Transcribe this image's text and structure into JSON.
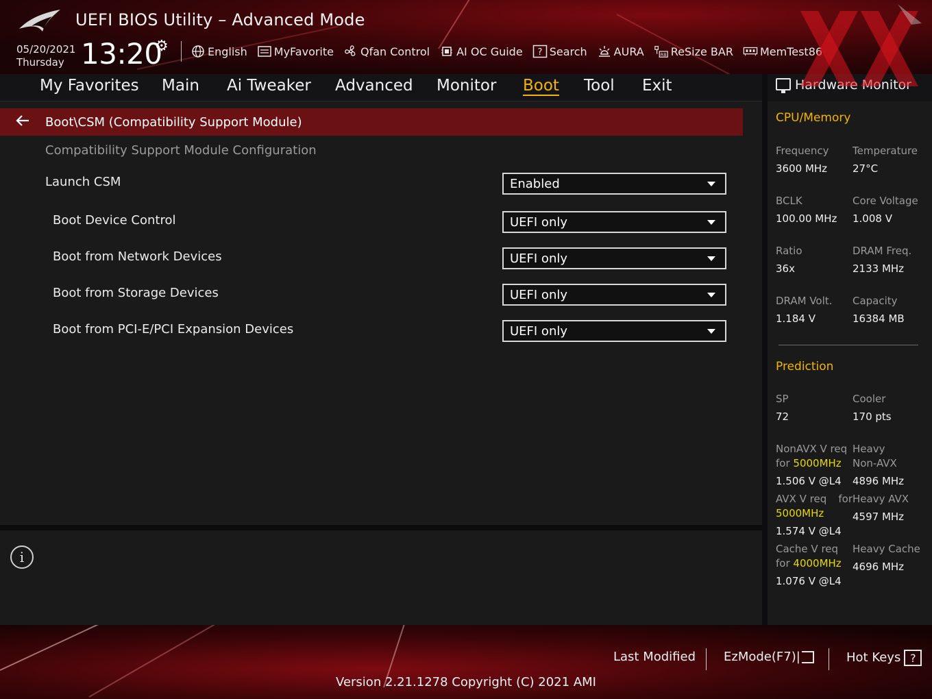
{
  "header": {
    "title": "UEFI BIOS Utility – Advanced Mode",
    "date": "05/20/2021",
    "day": "Thursday",
    "time": "13:20"
  },
  "toolbar": {
    "items": [
      {
        "label": "English",
        "icon": "globe-icon"
      },
      {
        "label": "MyFavorite",
        "icon": "favorite-list-icon"
      },
      {
        "label": "Qfan Control",
        "icon": "fan-icon"
      },
      {
        "label": "AI OC Guide",
        "icon": "chip-icon"
      },
      {
        "label": "Search",
        "icon": "question-box-icon"
      },
      {
        "label": "AURA",
        "icon": "light-icon"
      },
      {
        "label": "ReSize BAR",
        "icon": "resize-bar-icon"
      },
      {
        "label": "MemTest86",
        "icon": "memory-icon"
      }
    ]
  },
  "tabs": [
    "My Favorites",
    "Main",
    "Ai Tweaker",
    "Advanced",
    "Monitor",
    "Boot",
    "Tool",
    "Exit"
  ],
  "active_tab": "Boot",
  "main": {
    "breadcrumb": "Boot\\CSM (Compatibility Support Module)",
    "section_title": "Compatibility Support Module Configuration",
    "settings": [
      {
        "label": "Launch CSM",
        "value": "Enabled"
      },
      {
        "label": "Boot Device Control",
        "value": "UEFI only"
      },
      {
        "label": "Boot from Network Devices",
        "value": "UEFI only"
      },
      {
        "label": "Boot from Storage Devices",
        "value": "UEFI only"
      },
      {
        "label": "Boot from PCI-E/PCI Expansion Devices",
        "value": "UEFI only"
      }
    ]
  },
  "hardware_monitor": {
    "title": "Hardware Monitor",
    "cpu_memory": {
      "title": "CPU/Memory",
      "frequency_label": "Frequency",
      "frequency": "3600 MHz",
      "temperature_label": "Temperature",
      "temperature": "27°C",
      "bclk_label": "BCLK",
      "bclk": "100.00 MHz",
      "core_voltage_label": "Core Voltage",
      "core_voltage": "1.008 V",
      "ratio_label": "Ratio",
      "ratio": "36x",
      "dram_freq_label": "DRAM Freq.",
      "dram_freq": "2133 MHz",
      "dram_volt_label": "DRAM Volt.",
      "dram_volt": "1.184 V",
      "capacity_label": "Capacity",
      "capacity": "16384 MB"
    },
    "prediction": {
      "title": "Prediction",
      "sp_label": "SP",
      "sp": "72",
      "cooler_label": "Cooler",
      "cooler": "170 pts",
      "nonavx_label_1": "NonAVX V req",
      "nonavx_label_2": "for",
      "nonavx_freq": "5000MHz",
      "nonavx_value": "1.506 V @L4",
      "heavy_nonavx_label_1": "Heavy",
      "heavy_nonavx_label_2": "Non-AVX",
      "heavy_nonavx_value": "4896 MHz",
      "avx_label_1": "AVX V req",
      "avx_label_2": "for",
      "avx_freq": "5000MHz",
      "avx_value": "1.574 V @L4",
      "heavy_avx_label": "Heavy AVX",
      "heavy_avx_value": "4597 MHz",
      "cache_label_1": "Cache V req",
      "cache_label_2": "for",
      "cache_freq": "4000MHz",
      "cache_value": "1.076 V @L4",
      "heavy_cache_label": "Heavy Cache",
      "heavy_cache_value": "4696 MHz"
    }
  },
  "bottom": {
    "last_modified": "Last Modified",
    "ezmode": "EzMode(F7)|",
    "hot_keys": "Hot Keys",
    "hot_keys_key": "?",
    "version": "Version 2.21.1278 Copyright (C) 2021 AMI"
  },
  "colors": {
    "accent": "#f4b400",
    "breadcrumb_bg": "#6a1114",
    "highlight": "#e6d800"
  }
}
